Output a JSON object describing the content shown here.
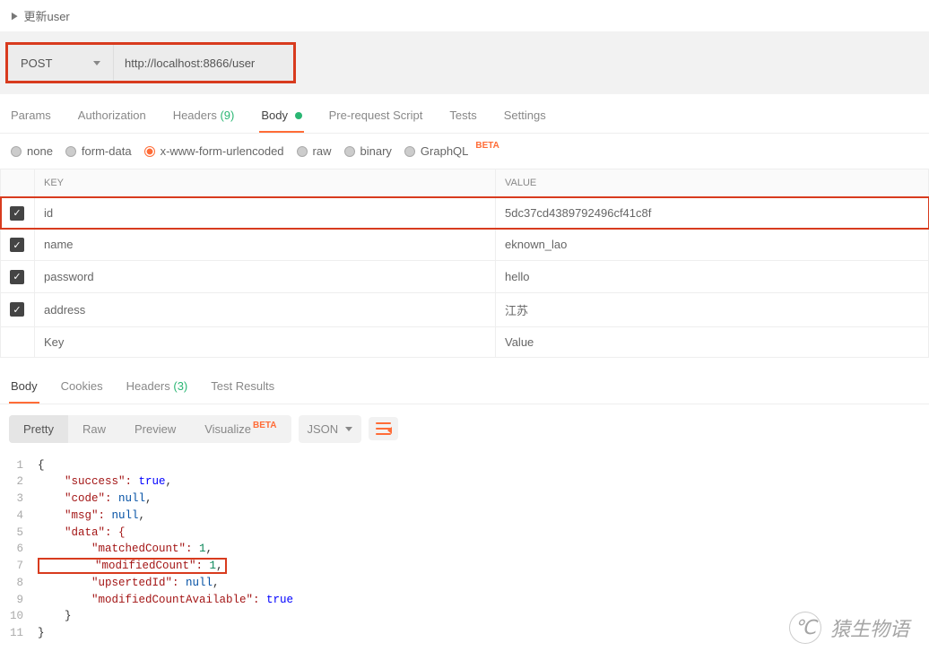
{
  "header": {
    "title": "更新user"
  },
  "request": {
    "method": "POST",
    "url": "http://localhost:8866/user"
  },
  "tabs": {
    "params": "Params",
    "auth": "Authorization",
    "headers_label": "Headers",
    "headers_count": "(9)",
    "body": "Body",
    "prereq": "Pre-request Script",
    "tests": "Tests",
    "settings": "Settings"
  },
  "body_types": {
    "none": "none",
    "formdata": "form-data",
    "xwww": "x-www-form-urlencoded",
    "raw": "raw",
    "binary": "binary",
    "graphql": "GraphQL",
    "beta": "BETA"
  },
  "kv": {
    "key_header": "KEY",
    "value_header": "VALUE",
    "rows": [
      {
        "key": "id",
        "value": "5dc37cd4389792496cf41c8f",
        "highlight": true
      },
      {
        "key": "name",
        "value": "eknown_lao"
      },
      {
        "key": "password",
        "value": "hello"
      },
      {
        "key": "address",
        "value": "江苏"
      }
    ],
    "placeholder_key": "Key",
    "placeholder_value": "Value"
  },
  "response_tabs": {
    "body": "Body",
    "cookies": "Cookies",
    "headers_label": "Headers",
    "headers_count": "(3)",
    "tests": "Test Results"
  },
  "toolbar": {
    "pretty": "Pretty",
    "raw": "Raw",
    "preview": "Preview",
    "visualize": "Visualize",
    "beta": "BETA",
    "format": "JSON"
  },
  "code": {
    "l1": "{",
    "l2a": "    \"success\": ",
    "l2b": "true",
    "l2c": ",",
    "l3a": "    \"code\": ",
    "l3b": "null",
    "l3c": ",",
    "l4a": "    \"msg\": ",
    "l4b": "null",
    "l4c": ",",
    "l5": "    \"data\": {",
    "l6a": "        \"matchedCount\": ",
    "l6b": "1",
    "l6c": ",",
    "l7a": "        \"modifiedCount\": ",
    "l7b": "1",
    "l7c": ",",
    "l8a": "        \"upsertedId\": ",
    "l8b": "null",
    "l8c": ",",
    "l9a": "        \"modifiedCountAvailable\": ",
    "l9b": "true",
    "l10": "    }",
    "l11": "}"
  },
  "watermark": {
    "text": "猿生物语"
  }
}
